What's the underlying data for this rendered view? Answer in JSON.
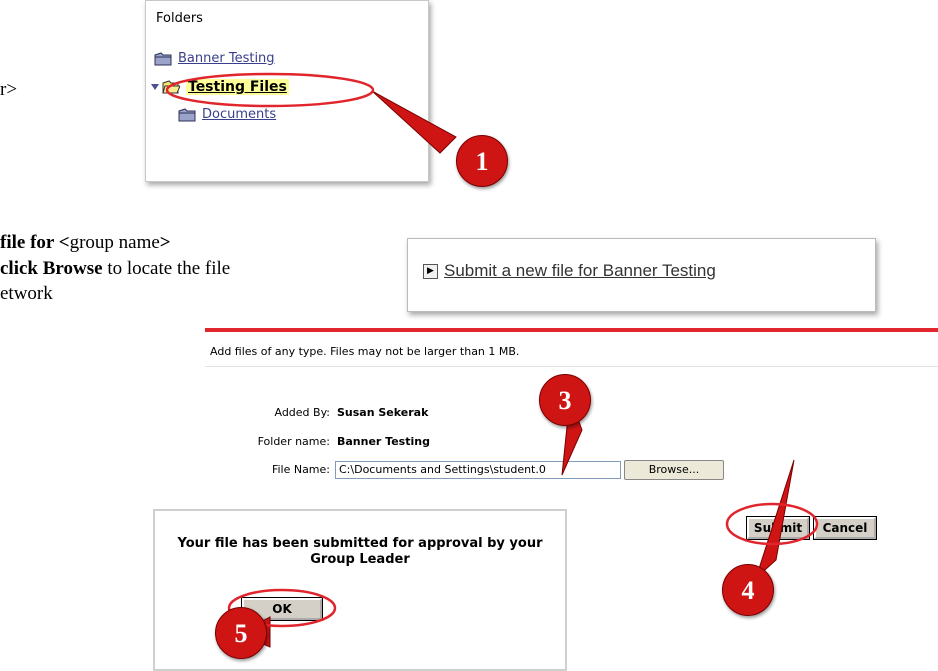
{
  "instructions": {
    "line1_tail": "r>",
    "line2_bold": "file for <",
    "line2_normal": "group name",
    "line2_end": ">",
    "line3_bold": "click Browse",
    "line3_normal": " to locate the file",
    "line4": "etwork"
  },
  "folders_panel": {
    "header": "Folders",
    "items": [
      {
        "label": "Banner Testing"
      },
      {
        "label": "Testing Files"
      },
      {
        "label": "Documents"
      }
    ]
  },
  "submit_link": {
    "label": "Submit a new file for Banner Testing"
  },
  "form": {
    "help_text": "Add files of any type. Files may not be larger than 1 MB.",
    "added_by_label": "Added By:",
    "added_by_value": "Susan Sekerak",
    "folder_name_label": "Folder name:",
    "folder_name_value": "Banner Testing",
    "file_name_label": "File Name:",
    "file_name_value": "C:\\Documents and Settings\\student.0",
    "browse_label": "Browse...",
    "submit_label": "Submit",
    "cancel_label": "Cancel"
  },
  "dialog": {
    "message_line1": "Your file has been submitted for approval by your",
    "message_line2": "Group Leader",
    "ok_label": "OK"
  },
  "badges": [
    "1",
    "3",
    "4",
    "5"
  ],
  "colors": {
    "badge_red": "#cf1414",
    "highlight_ring": "#e0262c",
    "link_blue": "#3a3f8c",
    "selected_folder_bg": "#ffff99"
  }
}
